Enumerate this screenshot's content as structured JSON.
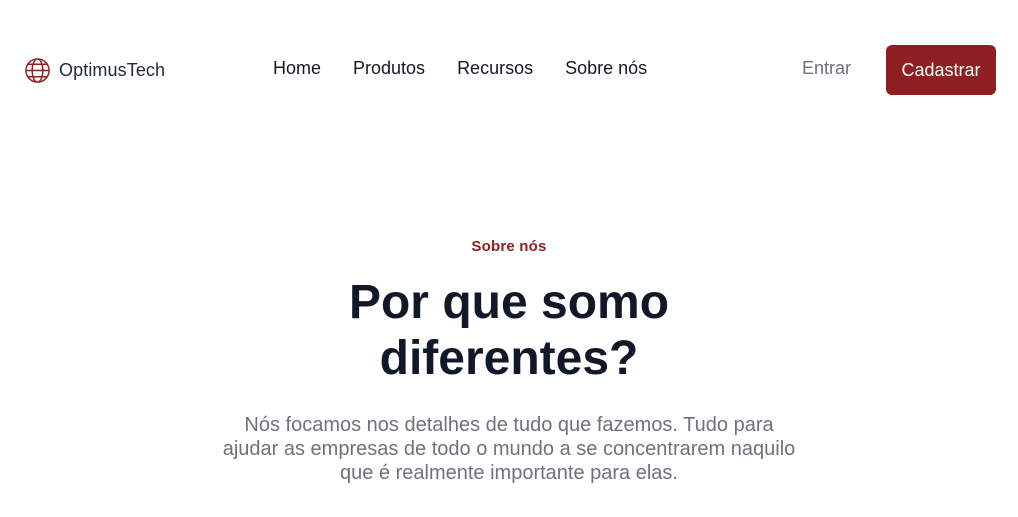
{
  "brand": {
    "name": "OptimusTech",
    "logo_icon": "globe-icon",
    "accent_color": "#8f1f22"
  },
  "nav": {
    "links": [
      "Home",
      "Produtos",
      "Recursos",
      "Sobre nós"
    ],
    "login_label": "Entrar",
    "signup_label": "Cadastrar"
  },
  "hero": {
    "eyebrow": "Sobre nós",
    "headline": "Por que somo diferentes?",
    "description": "Nós focamos nos detalhes de tudo que fazemos. Tudo para ajudar as empresas de todo o mundo a se concentrarem naquilo que é realmente importante para elas."
  }
}
